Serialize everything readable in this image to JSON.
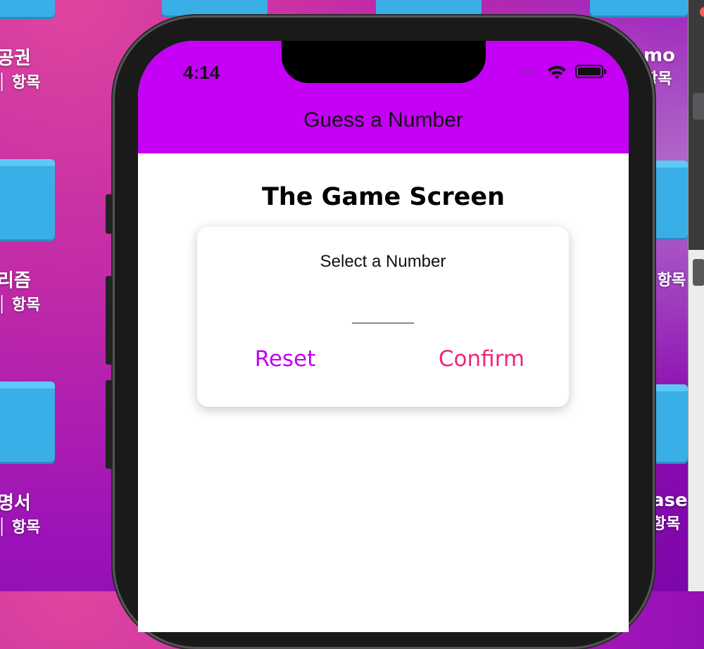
{
  "desktop": {
    "left_labels": [
      {
        "title": "공권",
        "subtitle": "│ 항목"
      },
      {
        "title": "리즘",
        "subtitle": "│ 항목"
      },
      {
        "title": "명서",
        "subtitle": "│ 항목"
      }
    ],
    "right_labels": [
      {
        "title": "mo",
        "subtitle": "항목"
      },
      {
        "title": "! 항목",
        "subtitle": ""
      },
      {
        "title": "ase",
        "subtitle": "항목"
      }
    ]
  },
  "phone": {
    "status_bar": {
      "time": "4:14"
    },
    "app": {
      "title": "Guess a Number",
      "screen_title": "The Game Screen",
      "card": {
        "label": "Select a Number",
        "input_value": "",
        "reset_label": "Reset",
        "confirm_label": "Confirm"
      }
    }
  },
  "colors": {
    "appbar": "#c400f5",
    "reset": "#c400f5",
    "confirm": "#f2257a"
  }
}
